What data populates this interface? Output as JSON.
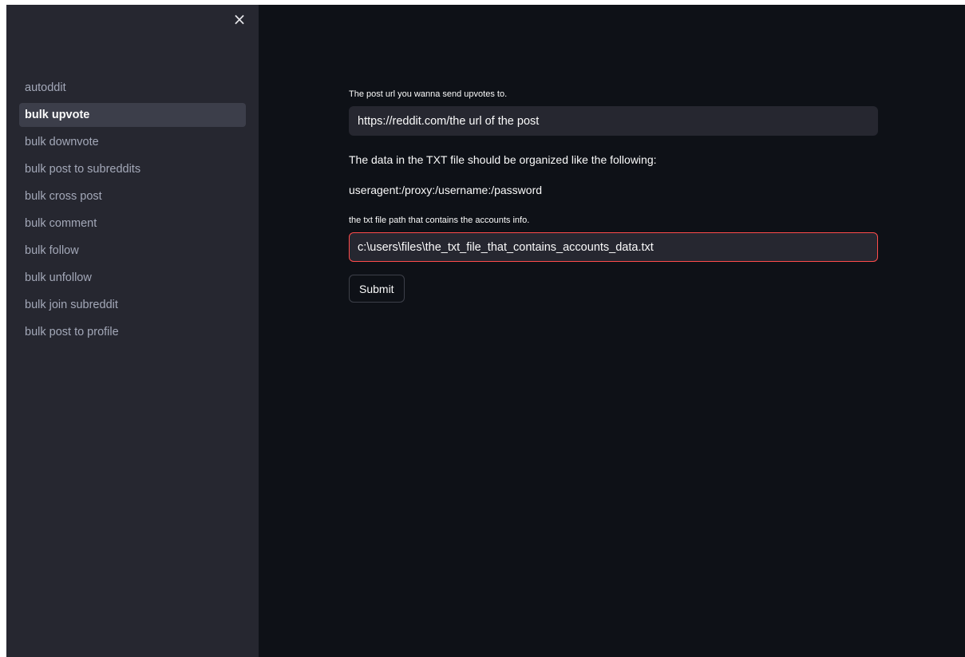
{
  "sidebar": {
    "close_icon": "×",
    "items": [
      {
        "label": "autoddit",
        "active": false
      },
      {
        "label": "bulk upvote",
        "active": true
      },
      {
        "label": "bulk downvote",
        "active": false
      },
      {
        "label": "bulk post to subreddits",
        "active": false
      },
      {
        "label": "bulk cross post",
        "active": false
      },
      {
        "label": "bulk comment",
        "active": false
      },
      {
        "label": "bulk follow",
        "active": false
      },
      {
        "label": "bulk unfollow",
        "active": false
      },
      {
        "label": "bulk join subreddit",
        "active": false
      },
      {
        "label": "bulk post to profile",
        "active": false
      }
    ]
  },
  "form": {
    "url_label": "The post url you wanna send upvotes to.",
    "url_value": "https://reddit.com/the url of the post",
    "format_text": "The data in the TXT file should be organized like the following:",
    "format_example": "useragent:/proxy:/username:/password",
    "path_label": "the txt file path that contains the accounts info.",
    "path_value": "c:\\users\\files\\the_txt_file_that_contains_accounts_data.txt",
    "submit_label": "Submit"
  },
  "colors": {
    "sidebar_bg": "#262730",
    "main_bg": "#0e1117",
    "focus_border": "#ff4b4b"
  }
}
